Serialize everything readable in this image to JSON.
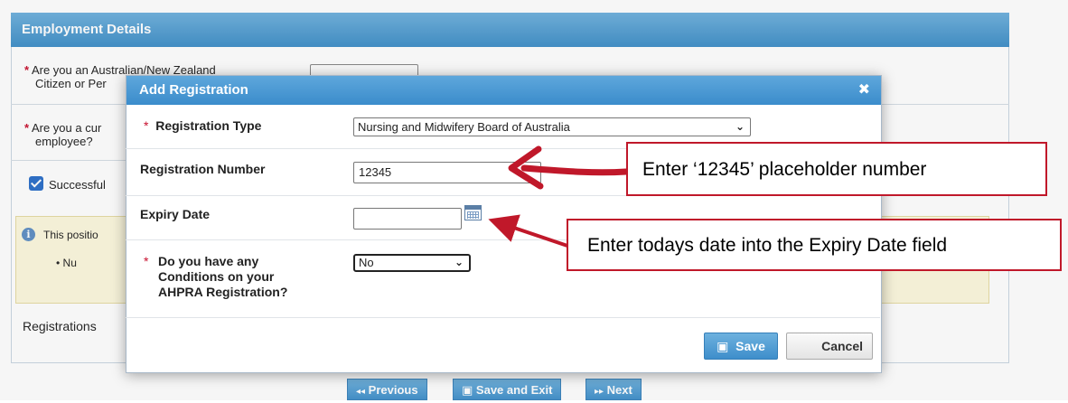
{
  "background": {
    "section_title": "Employment Details",
    "q1_line1": "Are you an Australian/New Zealand",
    "q1_line2": "Citizen or Per",
    "q2_line1": "Are you a cur",
    "q2_line2": "employee?",
    "checkbox_label": "Successful",
    "info_line1": "This positio",
    "info_line2": "Nu",
    "registrations_label": "Registrations"
  },
  "nav": {
    "previous": "Previous",
    "save_exit": "Save and Exit",
    "next": "Next"
  },
  "modal": {
    "title": "Add Registration",
    "close_glyph": "✖",
    "registration_type_label": "Registration Type",
    "registration_type_value": "Nursing and Midwifery Board of Australia",
    "registration_number_label": "Registration Number",
    "registration_number_value": "12345",
    "expiry_date_label": "Expiry Date",
    "expiry_date_value": "",
    "conditions_label_line1": "Do you have any",
    "conditions_label_line2": "Conditions on your",
    "conditions_label_line3": "AHPRA Registration?",
    "conditions_value": "No",
    "save_label": "Save",
    "cancel_label": "Cancel"
  },
  "annotations": {
    "callout_number": "Enter ‘12345’ placeholder number",
    "callout_date": "Enter todays date into the Expiry Date field",
    "color": "#c0182a"
  }
}
